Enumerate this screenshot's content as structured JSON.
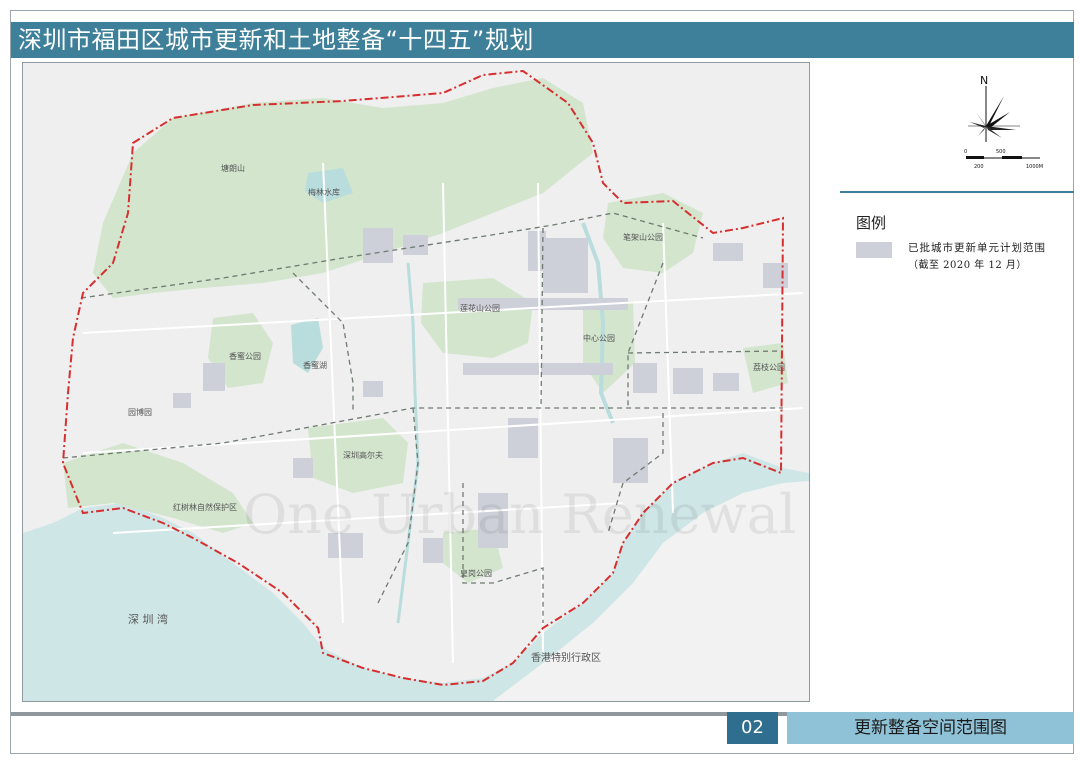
{
  "header": {
    "title": "深圳市福田区城市更新和土地整备“十四五”规划"
  },
  "map": {
    "watermark": "One Urban Renewal",
    "labels": {
      "tangnan_mountain": "塘朗山",
      "meilin_reservoir": "梅林水库",
      "bijiashan_park": "笔架山公园",
      "lianhuashan_park": "莲花山公园",
      "xiangmi_park": "香蜜公园",
      "xiangmi_lake": "香蜜湖",
      "central_park": "中心公园",
      "lizhi_park": "荔枝公园",
      "golf": "深圳高尔夫",
      "exhibition": "园博园",
      "mangrove": "红树林自然保护区",
      "huanggang_park": "皇岗公园",
      "shenzhen_bay": "深 圳 湾",
      "hk": "香港特别行政区"
    },
    "colors": {
      "water": "#cfe6e6",
      "land": "#efeff0",
      "green": "#d3e5cd",
      "boundary": "#d62f2f",
      "zone_line": "#6f7a70",
      "approved_unit": "#cdd0d8"
    }
  },
  "compass": {
    "north": "N",
    "scale_ticks": [
      "0",
      "500",
      "200",
      "1000M"
    ]
  },
  "legend": {
    "title": "图例",
    "item_label": "已批城市更新单元计划范围",
    "item_note": "（截至 2020 年 12 月）",
    "swatch_color": "#cdd0d8"
  },
  "footer": {
    "page_number": "02",
    "section_title": "更新整备空间范围图",
    "accent_color": "#2f6e8e",
    "label_color": "#8fc2d6"
  }
}
